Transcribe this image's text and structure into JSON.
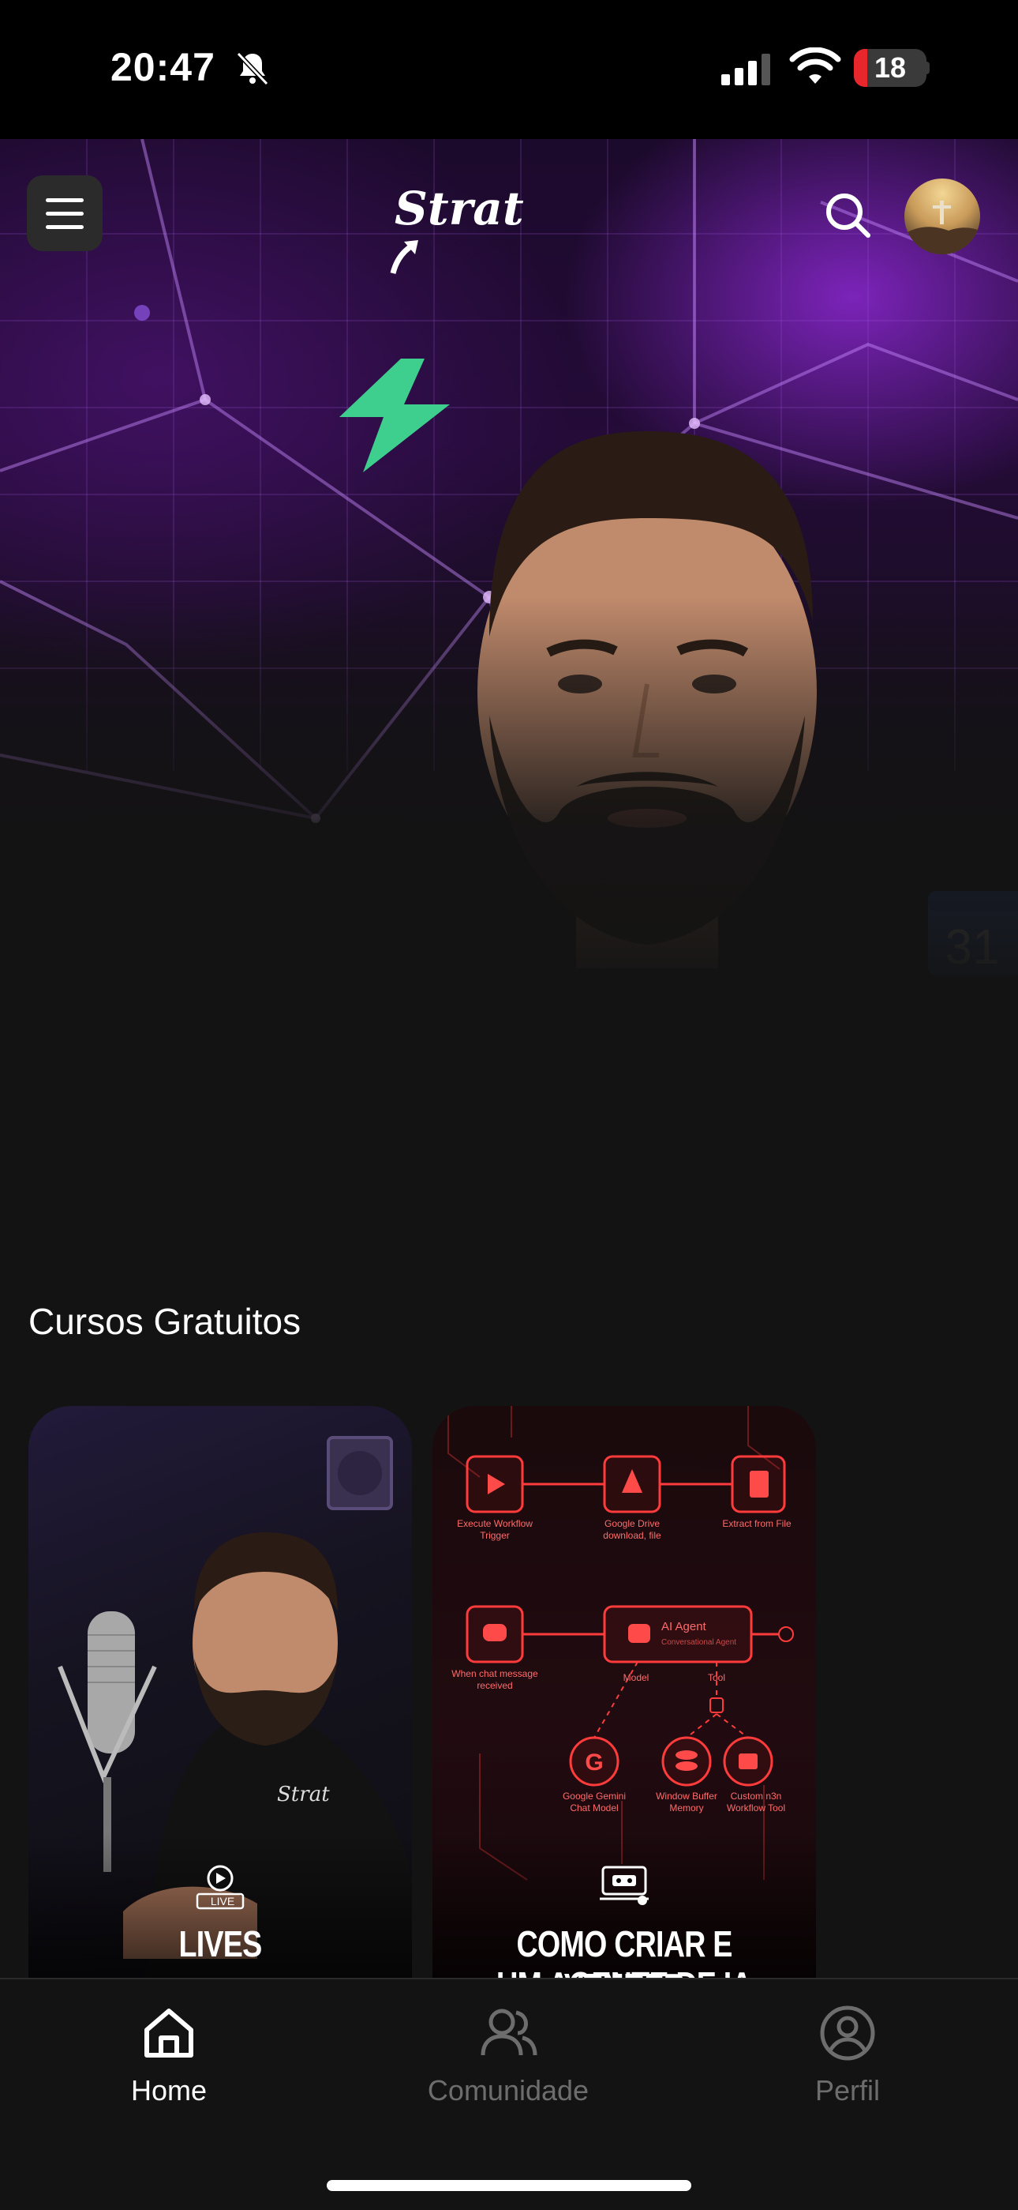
{
  "status_bar": {
    "time": "20:47",
    "battery_level": "18",
    "battery_fraction": 0.18,
    "icons": [
      "bell-off-icon",
      "signal-icon",
      "wifi-icon",
      "battery-icon"
    ]
  },
  "header": {
    "menu_icon": "menu-icon",
    "logo_text": "Strat",
    "search_icon": "search-icon",
    "avatar": "profile-avatar"
  },
  "hero": {
    "calendar_badge_text": "31",
    "colors": {
      "accent_purple": "#8a2be2",
      "bolt_green": "#3ecf8e"
    }
  },
  "section": {
    "title": "Cursos Gratuitos"
  },
  "courses": [
    {
      "title": "LIVES",
      "badge_text": "LIVE",
      "icon": "live-icon"
    },
    {
      "title": "COMO CRIAR E VENDER",
      "title_line2": "UM AGENTE DE IA",
      "icon": "course-icon",
      "workflow_nodes": [
        {
          "label": "Execute Workflow",
          "sublabel": "Trigger"
        },
        {
          "label": "Google Drive",
          "sublabel": "download, file"
        },
        {
          "label": "Extract from File",
          "sublabel": ""
        },
        {
          "label": "When chat message",
          "sublabel": "received"
        },
        {
          "label": "AI Agent",
          "sublabel": "Conversational Agent"
        },
        {
          "label": "Google Gemini",
          "sublabel": "Chat Model"
        },
        {
          "label": "Window Buffer",
          "sublabel": "Memory"
        },
        {
          "label": "Custom n3n",
          "sublabel": "Workflow Tool"
        }
      ],
      "connector_labels": [
        "Model",
        "Tool"
      ]
    }
  ],
  "bottom_nav": {
    "items": [
      {
        "label": "Home",
        "icon": "home-icon",
        "active": true
      },
      {
        "label": "Comunidade",
        "icon": "community-icon",
        "active": false
      },
      {
        "label": "Perfil",
        "icon": "profile-icon",
        "active": false
      }
    ],
    "active_color": "#ffffff",
    "inactive_color": "#6d6d6d"
  }
}
